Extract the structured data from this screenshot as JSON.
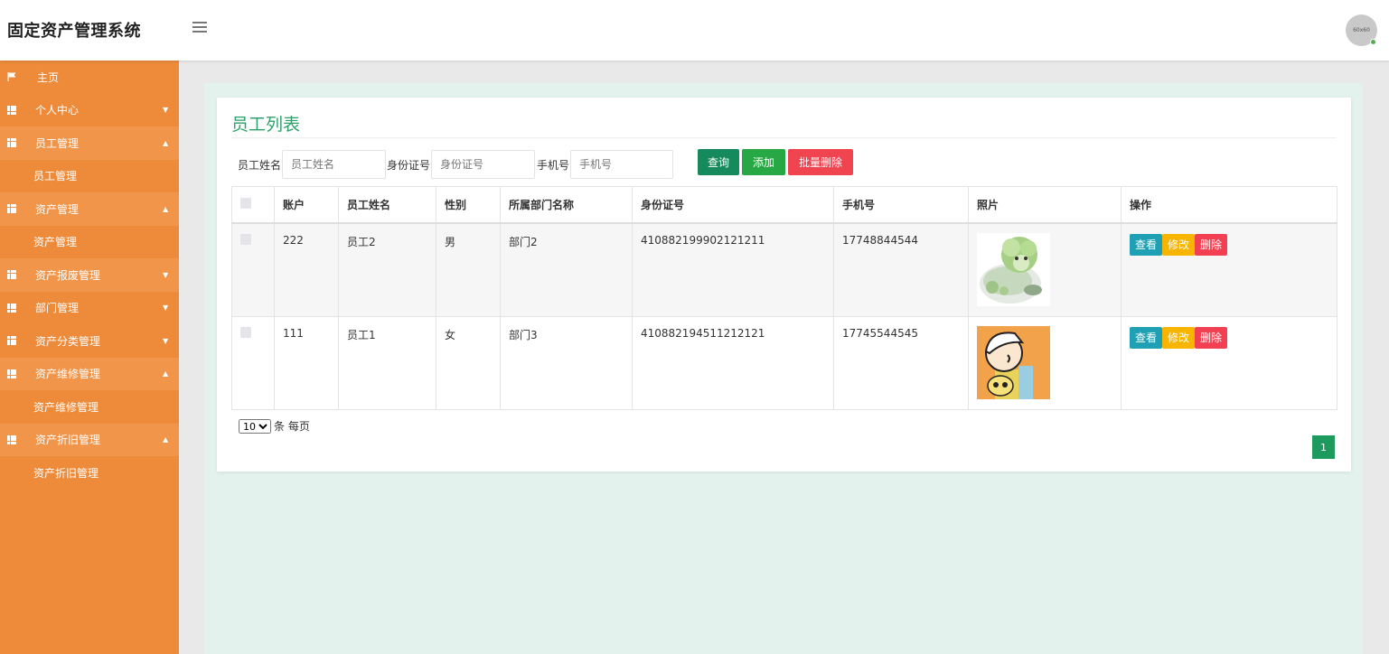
{
  "app": {
    "title": "固定资产管理系统",
    "avatar_text": "60x60"
  },
  "sidebar": {
    "items": [
      {
        "label": "主页"
      },
      {
        "label": "个人中心"
      },
      {
        "label": "员工管理",
        "sub": "员工管理"
      },
      {
        "label": "资产管理",
        "sub": "资产管理"
      },
      {
        "label": "资产报废管理"
      },
      {
        "label": "部门管理"
      },
      {
        "label": "资产分类管理"
      },
      {
        "label": "资产维修管理",
        "sub": "资产维修管理"
      },
      {
        "label": "资产折旧管理",
        "sub": "资产折旧管理"
      }
    ]
  },
  "page": {
    "title": "员工列表"
  },
  "search": {
    "name_label": "员工姓名",
    "name_placeholder": "员工姓名",
    "id_label": "身份证号",
    "id_placeholder": "身份证号",
    "phone_label": "手机号",
    "phone_placeholder": "手机号",
    "query": "查询",
    "add": "添加",
    "batch_delete": "批量删除"
  },
  "table": {
    "headers": [
      "账户",
      "员工姓名",
      "性别",
      "所属部门名称",
      "身份证号",
      "手机号",
      "照片",
      "操作"
    ],
    "rows": [
      {
        "account": "222",
        "name": "员工2",
        "gender": "男",
        "dept": "部门2",
        "id_card": "410882199902121211",
        "phone": "17748844544"
      },
      {
        "account": "111",
        "name": "员工1",
        "gender": "女",
        "dept": "部门3",
        "id_card": "410882194511212121",
        "phone": "17745544545"
      }
    ],
    "actions": {
      "view": "查看",
      "edit": "修改",
      "delete": "删除"
    }
  },
  "pagination": {
    "page_size": "10",
    "per_page_text": "条 每页",
    "current_page": "1"
  },
  "colors": {
    "sidebar": "#ee8b3b",
    "title": "#2ea06a",
    "query": "#168a5c",
    "add": "#28a745",
    "batch_delete": "#f04451",
    "view": "#1fa0b4",
    "edit": "#f7b500",
    "delete": "#f24052"
  }
}
